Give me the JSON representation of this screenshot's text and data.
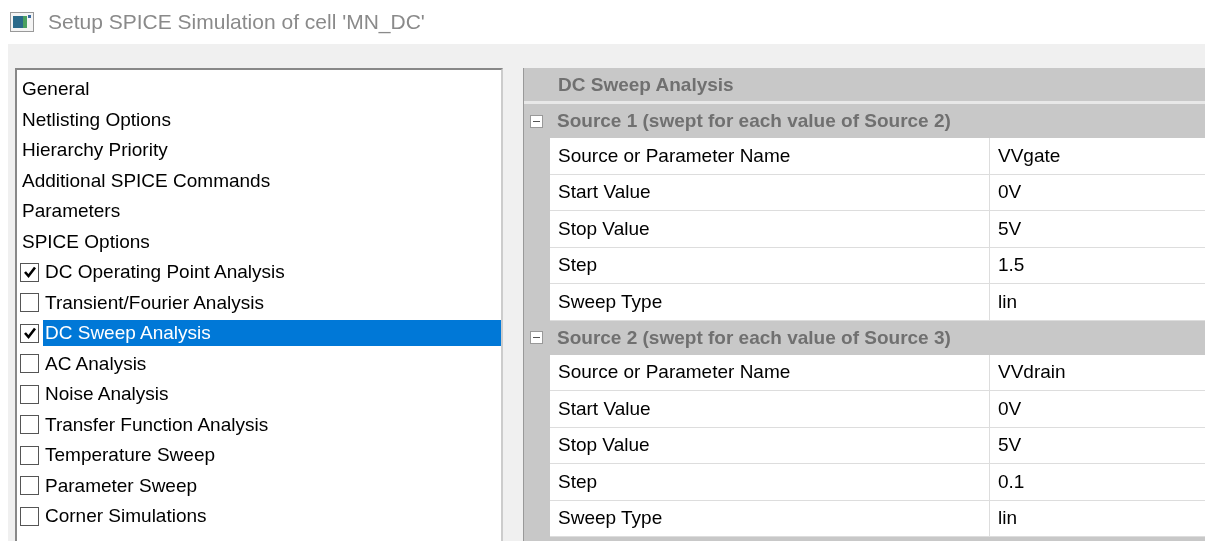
{
  "window": {
    "title": "Setup SPICE Simulation of cell 'MN_DC'"
  },
  "sidebar": {
    "items": [
      {
        "label": "General",
        "kind": "page",
        "selected": false
      },
      {
        "label": "Netlisting Options",
        "kind": "page",
        "selected": false
      },
      {
        "label": "Hierarchy Priority",
        "kind": "page",
        "selected": false
      },
      {
        "label": "Additional SPICE Commands",
        "kind": "page",
        "selected": false
      },
      {
        "label": "Parameters",
        "kind": "page",
        "selected": false
      },
      {
        "label": "SPICE Options",
        "kind": "page",
        "selected": false
      },
      {
        "label": "DC Operating Point Analysis",
        "kind": "analysis",
        "checked": true,
        "selected": false
      },
      {
        "label": "Transient/Fourier Analysis",
        "kind": "analysis",
        "checked": false,
        "selected": false
      },
      {
        "label": "DC Sweep Analysis",
        "kind": "analysis",
        "checked": true,
        "selected": true
      },
      {
        "label": "AC Analysis",
        "kind": "analysis",
        "checked": false,
        "selected": false
      },
      {
        "label": "Noise Analysis",
        "kind": "analysis",
        "checked": false,
        "selected": false
      },
      {
        "label": "Transfer Function Analysis",
        "kind": "analysis",
        "checked": false,
        "selected": false
      },
      {
        "label": "Temperature Sweep",
        "kind": "analysis",
        "checked": false,
        "selected": false
      },
      {
        "label": "Parameter Sweep",
        "kind": "analysis",
        "checked": false,
        "selected": false
      },
      {
        "label": "Corner Simulations",
        "kind": "analysis",
        "checked": false,
        "selected": false
      }
    ]
  },
  "property_grid": {
    "title": "DC Sweep Analysis",
    "sections": [
      {
        "title": "Source 1 (swept for each value of Source 2)",
        "expanded": true,
        "rows": [
          {
            "name": "Source or Parameter Name",
            "value": "VVgate"
          },
          {
            "name": "Start Value",
            "value": "0V"
          },
          {
            "name": "Stop Value",
            "value": "5V"
          },
          {
            "name": "Step",
            "value": "1.5"
          },
          {
            "name": "Sweep Type",
            "value": "lin"
          }
        ]
      },
      {
        "title": "Source 2 (swept for each value of Source 3)",
        "expanded": true,
        "rows": [
          {
            "name": "Source or Parameter Name",
            "value": "VVdrain"
          },
          {
            "name": "Start Value",
            "value": "0V"
          },
          {
            "name": "Stop Value",
            "value": "5V"
          },
          {
            "name": "Step",
            "value": "0.1"
          },
          {
            "name": "Sweep Type",
            "value": "lin"
          }
        ]
      }
    ]
  }
}
